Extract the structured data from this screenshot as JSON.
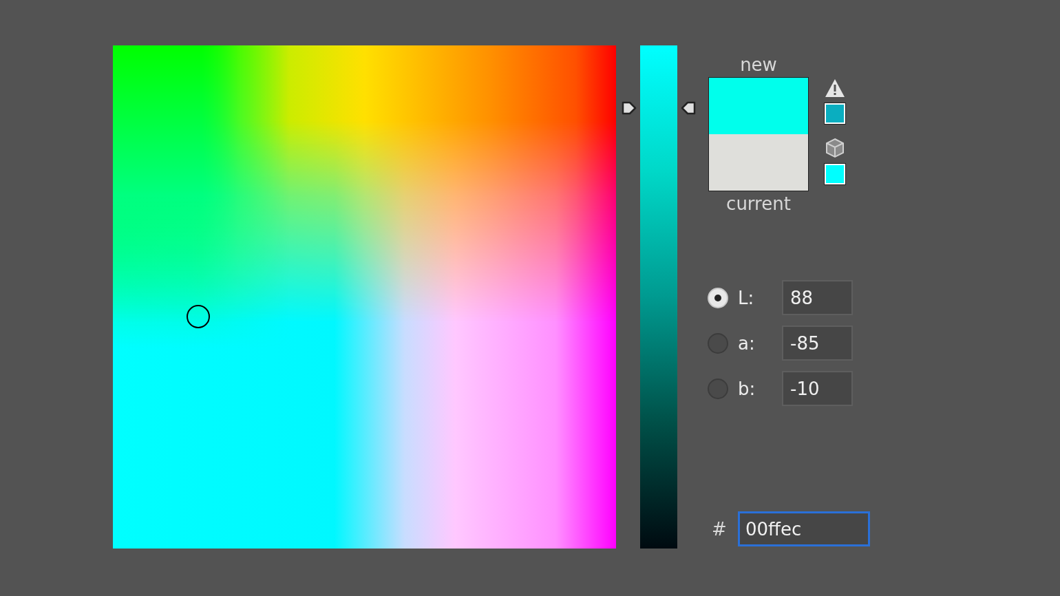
{
  "slider": {
    "level": 0.875
  },
  "swatches": [
    {
      "label": "new",
      "color": "#00ffec"
    },
    {
      "label": "current",
      "color": "#dfdfdb"
    }
  ],
  "alerts": [
    {
      "kind": "gamut",
      "color": "#0aaec0"
    },
    {
      "kind": "web",
      "color": "#00ffff"
    }
  ],
  "channels": [
    {
      "label": "L:",
      "value": "88",
      "selected": true
    },
    {
      "label": "a:",
      "value": "-85",
      "selected": false
    },
    {
      "label": "b:",
      "value": "-10",
      "selected": false
    }
  ],
  "hex": {
    "label": "#",
    "value": "00ffec",
    "focused": true
  }
}
